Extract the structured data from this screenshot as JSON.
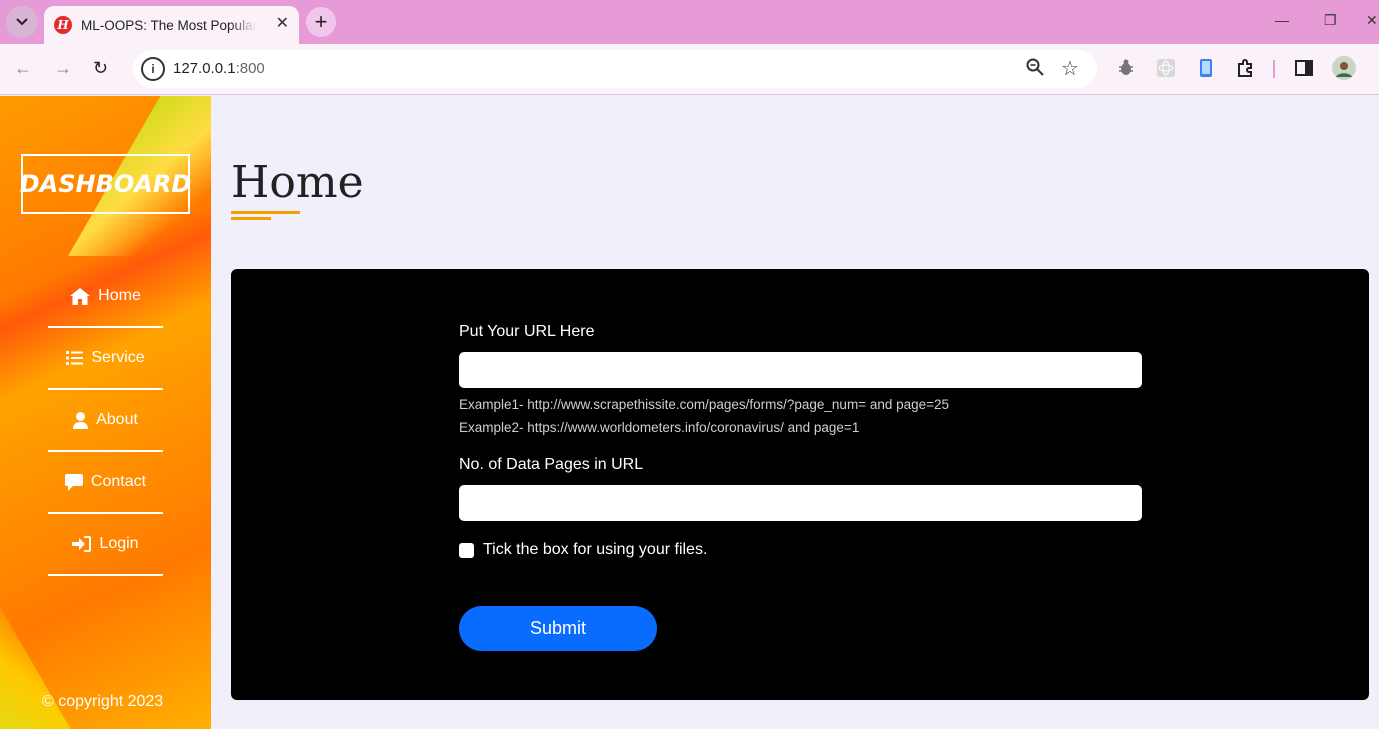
{
  "browser": {
    "tab_title": "ML-OOPS: The Most Popular W",
    "tab_favicon": "H",
    "url_host": "127.0.0.1",
    "url_port": ":800",
    "icons": [
      "chevron-down-icon",
      "close-icon",
      "plus-icon",
      "back-icon",
      "forward-icon",
      "reload-icon",
      "info-icon",
      "zoom-icon",
      "star-icon",
      "extension-icon",
      "sidepanel-icon",
      "profile-icon"
    ]
  },
  "sidebar": {
    "logo": "DASHBOARD",
    "items": [
      {
        "label": "Home",
        "icon": "home-icon"
      },
      {
        "label": "Service",
        "icon": "list-icon"
      },
      {
        "label": "About",
        "icon": "user-icon"
      },
      {
        "label": "Contact",
        "icon": "comment-icon"
      },
      {
        "label": "Login",
        "icon": "login-icon"
      }
    ],
    "copyright": "© copyright 2023"
  },
  "main": {
    "title": "Home",
    "form": {
      "url_label": "Put Your URL Here",
      "url_value": "",
      "example1": "Example1- http://www.scrapethissite.com/pages/forms/?page_num= and page=25",
      "example2": "Example2- https://www.worldometers.info/coronavirus/ and page=1",
      "pages_label": "No. of Data Pages in URL",
      "pages_value": "",
      "checkbox_label": "Tick the box for using your files.",
      "checkbox_checked": false,
      "submit_label": "Submit"
    }
  },
  "colors": {
    "accent": "#f2a100",
    "submit": "#0a6cff",
    "panel": "#000000",
    "tabbar": "#e69ad6"
  }
}
